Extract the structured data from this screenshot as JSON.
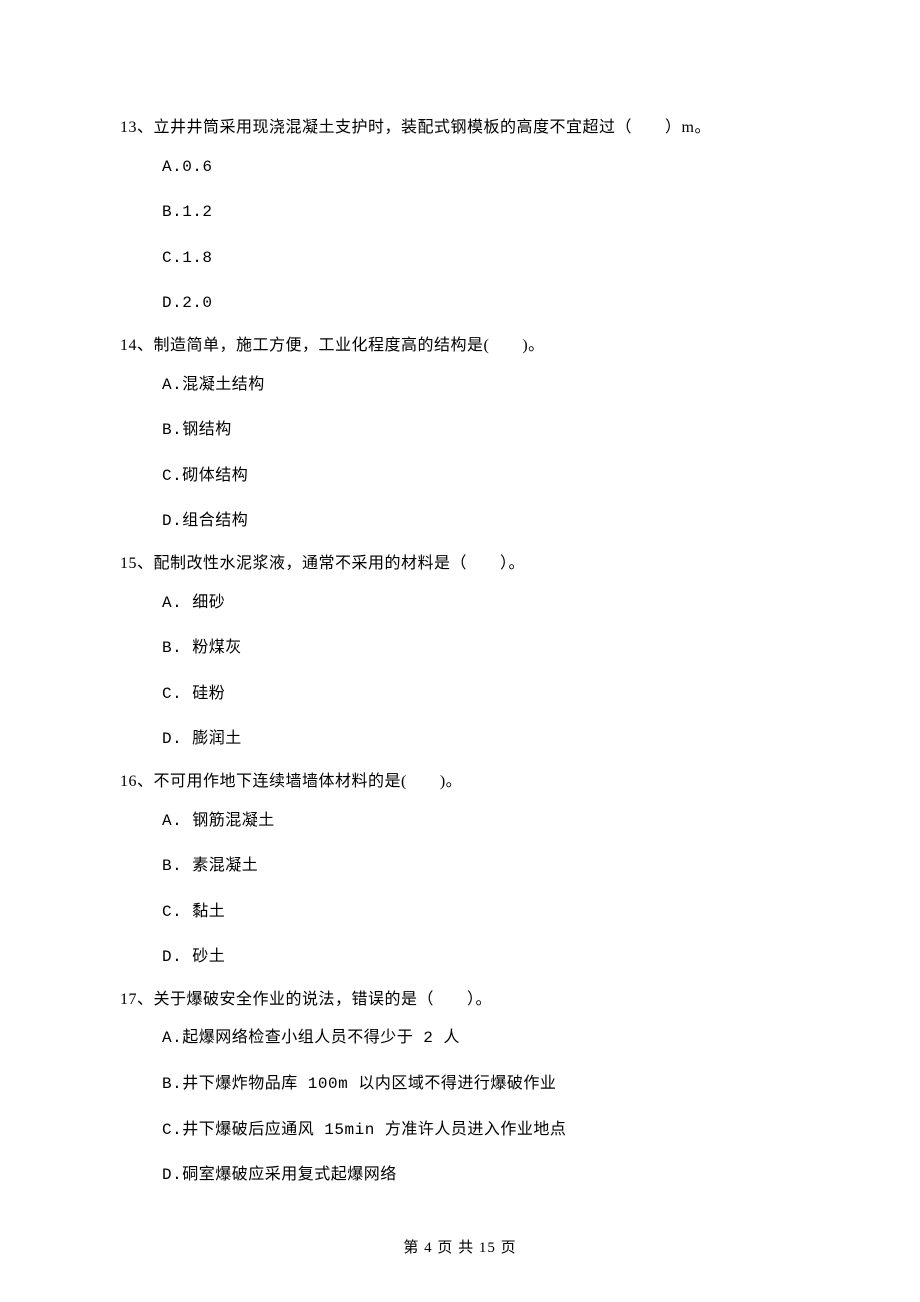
{
  "questions": [
    {
      "stem": "13、立井井筒采用现浇混凝土支护时，装配式钢模板的高度不宜超过（　　）m。",
      "options": [
        "A.0.6",
        "B.1.2",
        "C.1.8",
        "D.2.0"
      ]
    },
    {
      "stem": "14、制造简单，施工方便，工业化程度高的结构是(　　)。",
      "options": [
        "A.混凝土结构",
        "B.钢结构",
        "C.砌体结构",
        "D.组合结构"
      ]
    },
    {
      "stem": "15、配制改性水泥浆液，通常不采用的材料是（　　）。",
      "options": [
        "A. 细砂",
        "B. 粉煤灰",
        "C. 硅粉",
        "D. 膨润土"
      ]
    },
    {
      "stem": "16、不可用作地下连续墙墙体材料的是(　　)。",
      "options": [
        "A. 钢筋混凝土",
        "B. 素混凝土",
        "C. 黏土",
        "D. 砂土"
      ]
    },
    {
      "stem": "17、关于爆破安全作业的说法，错误的是（　　）。",
      "options": [
        "A.起爆网络检查小组人员不得少于 2 人",
        "B.井下爆炸物品库 100m 以内区域不得进行爆破作业",
        "C.井下爆破后应通风 15min 方准许人员进入作业地点",
        "D.硐室爆破应采用复式起爆网络"
      ]
    }
  ],
  "footer": "第 4 页 共 15 页"
}
